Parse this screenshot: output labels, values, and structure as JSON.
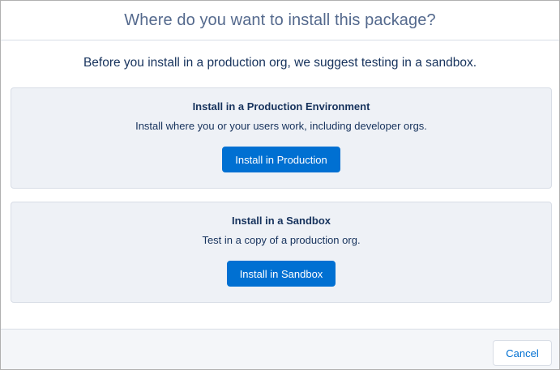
{
  "modal": {
    "title": "Where do you want to install this package?",
    "intro": "Before you install in a production org, we suggest testing in a sandbox."
  },
  "production": {
    "title": "Install in a Production Environment",
    "description": "Install where you or your users work, including developer orgs.",
    "button_label": "Install in Production"
  },
  "sandbox": {
    "title": "Install in a Sandbox",
    "description": "Test in a copy of a production org.",
    "button_label": "Install in Sandbox"
  },
  "footer": {
    "cancel_label": "Cancel"
  },
  "colors": {
    "brand": "#0070d2",
    "card_background": "#eef1f6",
    "footer_background": "#f4f6f9",
    "text": "#16325c",
    "title_text": "#54698d"
  }
}
